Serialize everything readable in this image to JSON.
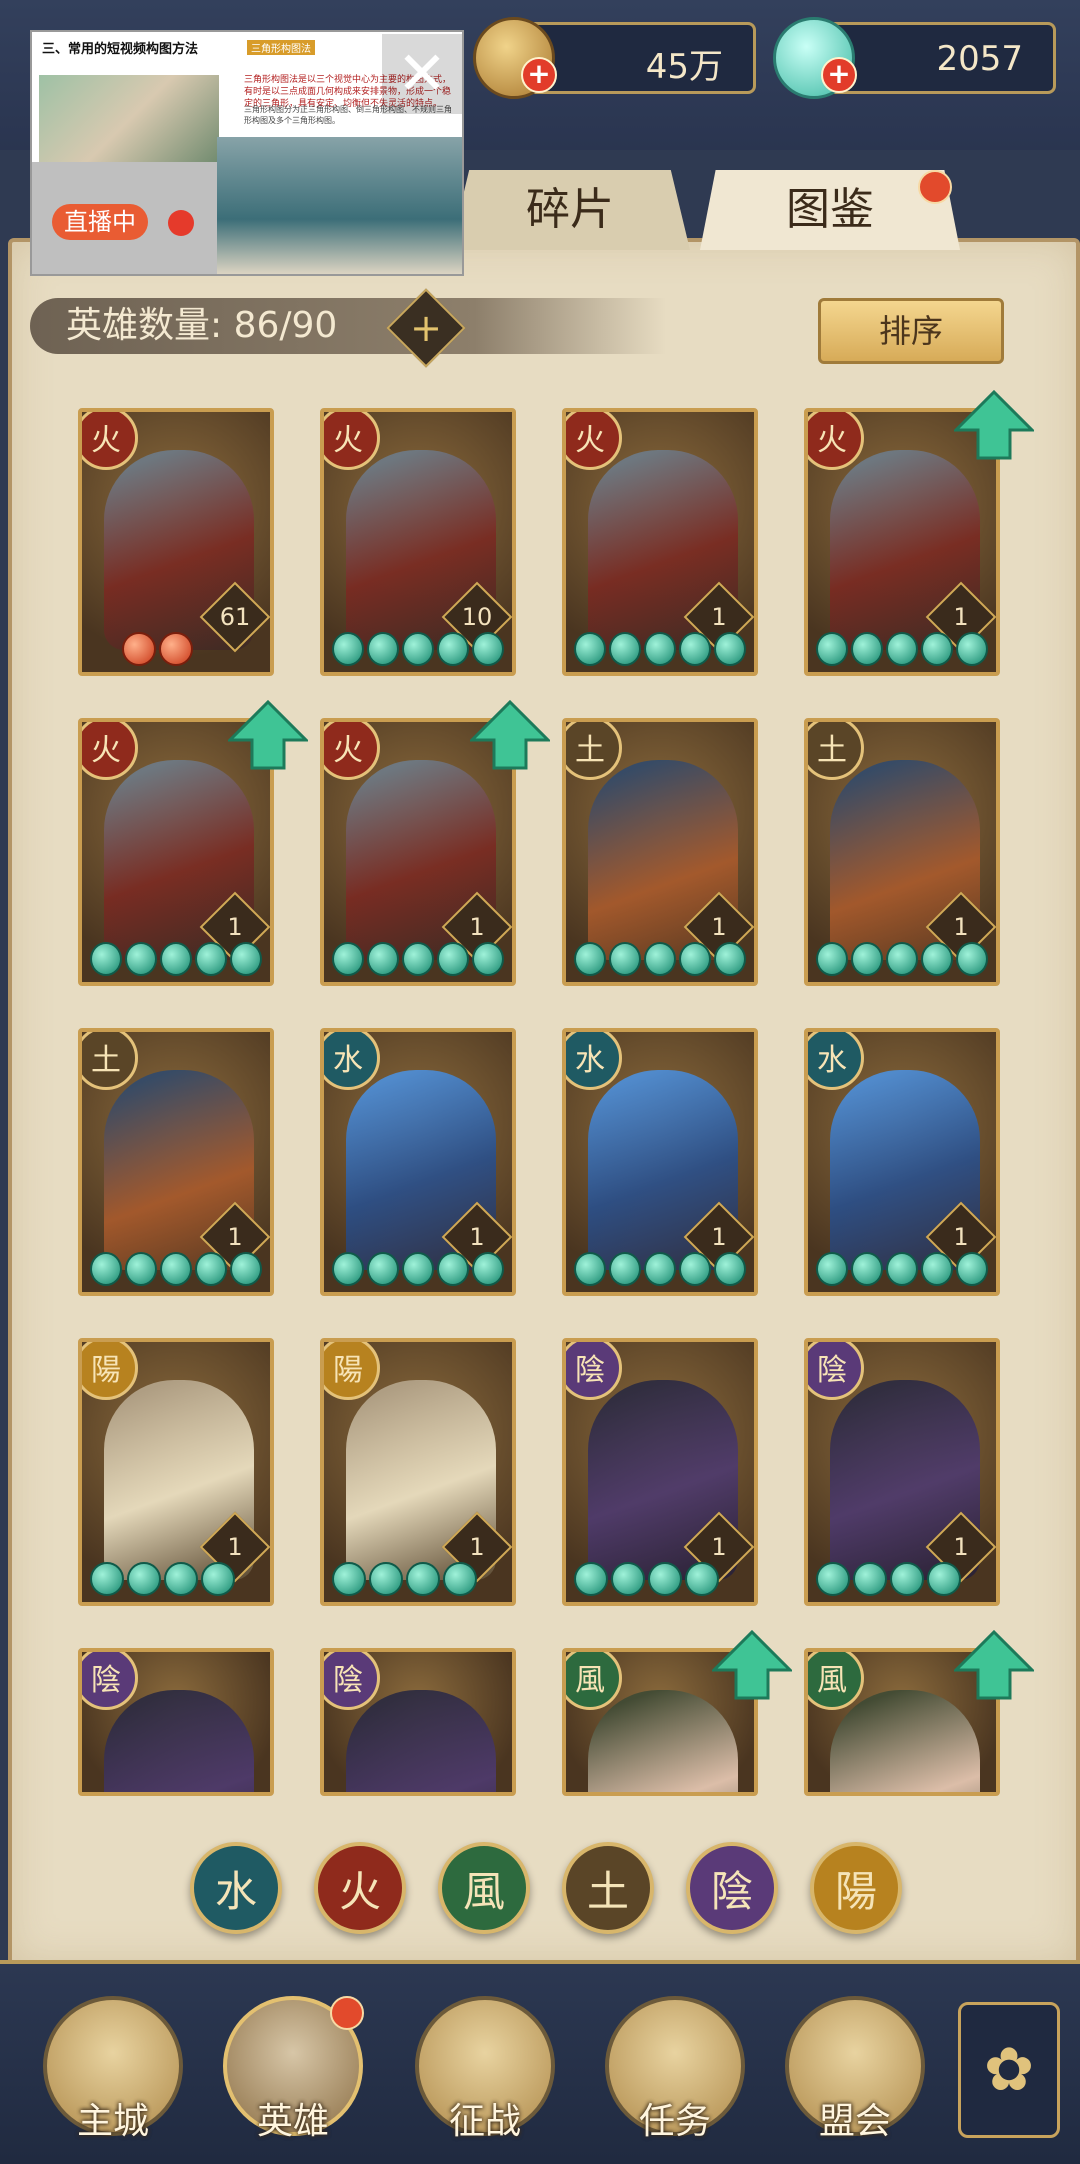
{
  "currency": {
    "coins": "45万",
    "jade": "2057"
  },
  "tabs": {
    "fragments": "碎片",
    "atlas": "图鉴"
  },
  "hero_count": {
    "label": "英雄数量:",
    "value": "86/90"
  },
  "sort_label": "排序",
  "cards": [
    {
      "element": "火",
      "level": "61",
      "stars": 2,
      "star_color": "red",
      "upgrade": false
    },
    {
      "element": "火",
      "level": "10",
      "stars": 5,
      "star_color": "green",
      "upgrade": false
    },
    {
      "element": "火",
      "level": "1",
      "stars": 5,
      "star_color": "green",
      "upgrade": false
    },
    {
      "element": "火",
      "level": "1",
      "stars": 5,
      "star_color": "green",
      "upgrade": true
    },
    {
      "element": "火",
      "level": "1",
      "stars": 5,
      "star_color": "green",
      "upgrade": true
    },
    {
      "element": "火",
      "level": "1",
      "stars": 5,
      "star_color": "green",
      "upgrade": true
    },
    {
      "element": "土",
      "level": "1",
      "stars": 5,
      "star_color": "green",
      "upgrade": false
    },
    {
      "element": "土",
      "level": "1",
      "stars": 5,
      "star_color": "green",
      "upgrade": false
    },
    {
      "element": "土",
      "level": "1",
      "stars": 5,
      "star_color": "green",
      "upgrade": false
    },
    {
      "element": "水",
      "level": "1",
      "stars": 5,
      "star_color": "green",
      "upgrade": false
    },
    {
      "element": "水",
      "level": "1",
      "stars": 5,
      "star_color": "green",
      "upgrade": false
    },
    {
      "element": "水",
      "level": "1",
      "stars": 5,
      "star_color": "green",
      "upgrade": false
    },
    {
      "element": "陽",
      "level": "1",
      "stars": 4,
      "star_color": "green",
      "upgrade": false
    },
    {
      "element": "陽",
      "level": "1",
      "stars": 4,
      "star_color": "green",
      "upgrade": false
    },
    {
      "element": "陰",
      "level": "1",
      "stars": 4,
      "star_color": "green",
      "upgrade": false
    },
    {
      "element": "陰",
      "level": "1",
      "stars": 4,
      "star_color": "green",
      "upgrade": false
    },
    {
      "element": "陰",
      "level": "",
      "stars": 0,
      "star_color": "green",
      "upgrade": false
    },
    {
      "element": "陰",
      "level": "",
      "stars": 0,
      "star_color": "green",
      "upgrade": false
    },
    {
      "element": "風",
      "level": "",
      "stars": 0,
      "star_color": "green",
      "upgrade": true
    },
    {
      "element": "風",
      "level": "",
      "stars": 0,
      "star_color": "green",
      "upgrade": true
    }
  ],
  "filters": [
    "水",
    "火",
    "風",
    "土",
    "陰",
    "陽"
  ],
  "nav": [
    "主城",
    "英雄",
    "征战",
    "任务",
    "盟会"
  ],
  "overlay": {
    "doc_title": "三、常用的短视频构图方法",
    "doc_tag": "三角形构图法",
    "live": "直播中",
    "paragraph_red": "三角形构图法是以三个视觉中心为主要的构图方式，有时是以三点成面几何构成来安排景物，形成一个稳定的三角形，具有安定、均衡但不失灵活的特点。",
    "paragraph_grey": "三角形构图分为正三角形构图、倒三角形构图、不规则三角形构图及多个三角形构图。"
  },
  "colors": {
    "fire": "#8f2a1c",
    "earth": "#5a4527",
    "water": "#1f5a63",
    "yang": "#b7821f",
    "yin": "#5a3a78",
    "wind": "#2d6a3e"
  }
}
